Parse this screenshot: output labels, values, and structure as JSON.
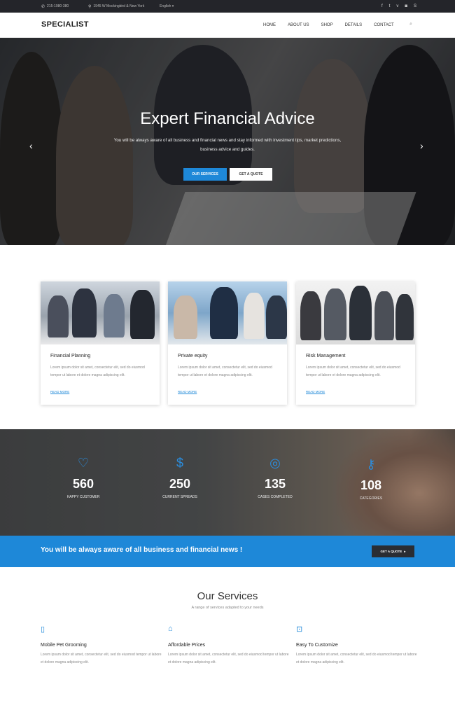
{
  "topbar": {
    "phone": "215-1980-380",
    "address": "1945 W Mockingbird & New York",
    "language": "English ▾",
    "social_icons": [
      "facebook-icon",
      "twitter-icon",
      "vine-icon",
      "instagram-icon",
      "skype-icon"
    ],
    "social_glyphs": [
      "f",
      "t",
      "v",
      "◙",
      "S"
    ]
  },
  "nav": {
    "brand": "SPECIALIST",
    "items": [
      "HOME",
      "ABOUT US",
      "SHOP",
      "DETAILS",
      "CONTACT"
    ]
  },
  "hero": {
    "title": "Expert Financial Advice",
    "subtitle": "You will be always aware of all business and financial news and stay informed with investment tips, market predictions, business advice and guides.",
    "btn_primary": "OUR SERVICES",
    "btn_secondary": "GET A QUOTE",
    "prev_arrow": "‹",
    "next_arrow": "›"
  },
  "cards": [
    {
      "title": "Financial Planning",
      "text": "Lorem ipsum dolor sit amet, consectetur elit, sed do eiusmod tempor ut labore et dolore magna adipiscing elit.",
      "link": "READ MORE"
    },
    {
      "title": "Private equity",
      "text": "Lorem ipsum dolor sit amet, consectetur elit, sed do eiusmod tempor ut labore et dolore magna adipiscing elit.",
      "link": "READ MORE"
    },
    {
      "title": "Risk Management",
      "text": "Lorem ipsum dolor sit amet, consectetur elit, sed do eiusmod tempor ut labore et dolore magna adipiscing elit.",
      "link": "READ MORE"
    }
  ],
  "stats": [
    {
      "icon": "heart-icon",
      "glyph": "♡",
      "number": "560",
      "label": "HAPPY CUSTOMER"
    },
    {
      "icon": "dollar-icon",
      "glyph": "$",
      "number": "250",
      "label": "CURRENT SPREADS"
    },
    {
      "icon": "pin-icon",
      "glyph": "◎",
      "number": "135",
      "label": "CASES COMPLETED"
    },
    {
      "icon": "key-icon",
      "glyph": "⚷",
      "number": "108",
      "label": "CATEGORIES"
    }
  ],
  "banner": {
    "text": "You will be always aware of all business and financial news !",
    "button": "GET A QUOTE",
    "button_arrow": "▸"
  },
  "services": {
    "title": "Our Services",
    "subtitle": "A range of services adapted to your needs",
    "items": [
      {
        "icon": "mobile-icon",
        "glyph": "▯",
        "title": "Mobile Pet Grooming",
        "text": "Lorem ipsum dolor sit amet, consectetur elit, sed do eiusmod tempor ut labore et dolore magna adipiscing elit."
      },
      {
        "icon": "tag-icon",
        "glyph": "⌂",
        "title": "Affordable Prices",
        "text": "Lorem ipsum dolor sit amet, consectetur elit, sed do eiusmod tempor ut labore et dolore magna adipiscing elit."
      },
      {
        "icon": "lock-icon",
        "glyph": "⊡",
        "title": "Easy To Customize",
        "text": "Lorem ipsum dolor sit amet, consectetur elit, sed do eiusmod tempor ut labore et dolore magna adipiscing elit."
      }
    ]
  },
  "colors": {
    "accent": "#1e88d8",
    "topbar": "#24252a",
    "dark_button": "#2a2d33"
  }
}
